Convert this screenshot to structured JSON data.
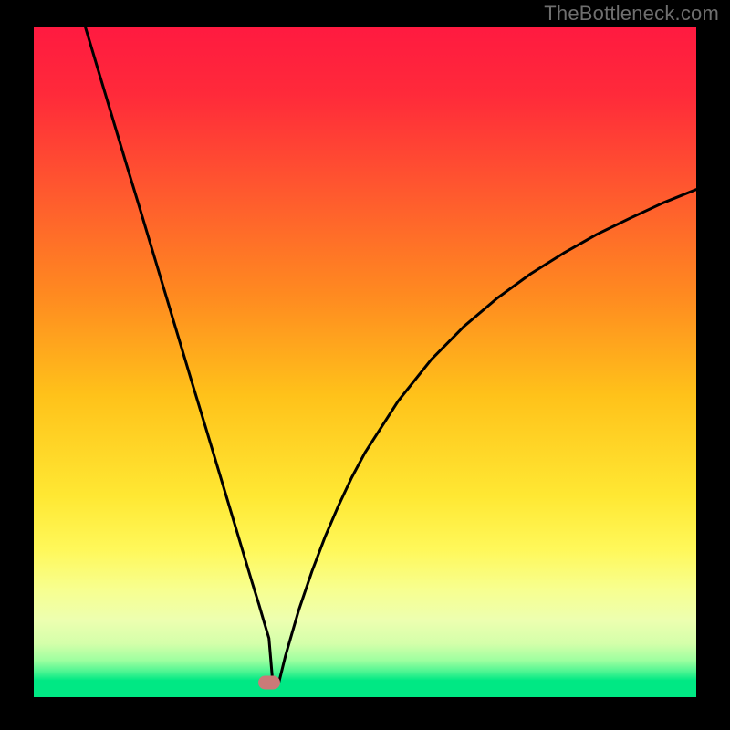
{
  "watermark": "TheBottleneck.com",
  "colors": {
    "frame": "#000000",
    "watermark": "#6f6f6f",
    "curve": "#000000",
    "marker": "#cb7a78",
    "gradient_stops": [
      {
        "offset": 0.0,
        "color": "#ff1a40"
      },
      {
        "offset": 0.1,
        "color": "#ff2a3a"
      },
      {
        "offset": 0.25,
        "color": "#ff5a2e"
      },
      {
        "offset": 0.4,
        "color": "#ff8a20"
      },
      {
        "offset": 0.55,
        "color": "#ffc21a"
      },
      {
        "offset": 0.7,
        "color": "#ffe833"
      },
      {
        "offset": 0.78,
        "color": "#fff85a"
      },
      {
        "offset": 0.84,
        "color": "#f7ff90"
      },
      {
        "offset": 0.885,
        "color": "#edffb0"
      },
      {
        "offset": 0.92,
        "color": "#d4ffaa"
      },
      {
        "offset": 0.945,
        "color": "#9effa0"
      },
      {
        "offset": 0.962,
        "color": "#4cf592"
      },
      {
        "offset": 0.975,
        "color": "#00e884"
      },
      {
        "offset": 1.0,
        "color": "#00e884"
      }
    ]
  },
  "chart_data": {
    "type": "line",
    "title": "",
    "xlabel": "",
    "ylabel": "",
    "xlim": [
      0,
      100
    ],
    "ylim": [
      0,
      100
    ],
    "grid": false,
    "legend": false,
    "series": [
      {
        "name": "curve",
        "x": [
          7.8,
          10,
          12,
          14,
          16,
          18,
          20,
          22,
          24,
          26,
          28,
          30,
          32,
          33,
          34,
          34.8,
          35.5,
          36,
          37,
          38,
          40,
          42,
          44,
          46,
          48,
          50,
          55,
          60,
          65,
          70,
          75,
          80,
          85,
          90,
          95,
          100
        ],
        "y": [
          100,
          92.7,
          86.1,
          79.5,
          73.0,
          66.4,
          59.8,
          53.2,
          46.6,
          40.1,
          33.5,
          26.9,
          20.3,
          17.0,
          13.8,
          11.1,
          8.8,
          3.0,
          2.2,
          6.2,
          13.0,
          18.8,
          24.0,
          28.6,
          32.8,
          36.5,
          44.2,
          50.4,
          55.4,
          59.6,
          63.2,
          66.3,
          69.1,
          71.5,
          73.8,
          75.8
        ]
      }
    ],
    "marker": {
      "x": 35.6,
      "y": 2.2
    },
    "notes": "V-shaped bottleneck curve over rainbow heat gradient. Values estimated from pixel positions; axes unlabeled in source image."
  }
}
